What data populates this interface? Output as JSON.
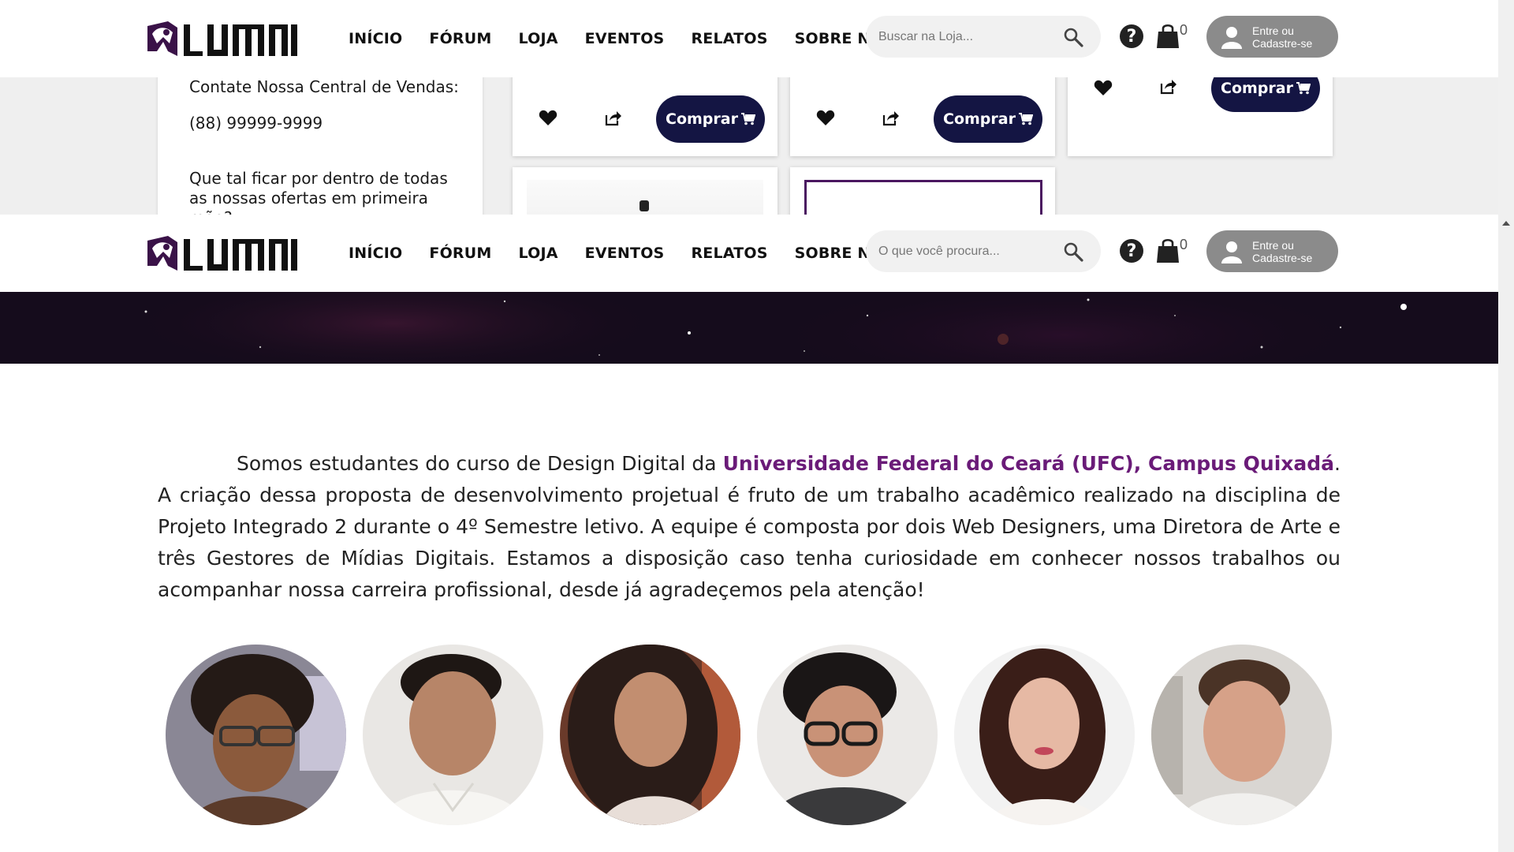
{
  "brand": {
    "name": "LUMNI",
    "accent": "#6a1b78",
    "dark_button": "#141543"
  },
  "nav": {
    "items": [
      "INÍCIO",
      "FÓRUM",
      "LOJA",
      "EVENTOS",
      "RELATOS",
      "SOBRE NÓS"
    ]
  },
  "top_header": {
    "search_placeholder": "Buscar na Loja...",
    "cart_count": "0",
    "login_line1": "Entre ou",
    "login_line2": "Cadastre-se"
  },
  "main_header": {
    "search_placeholder": "O que você procura...",
    "cart_count": "0",
    "login_line1": "Entre ou",
    "login_line2": "Cadastre-se"
  },
  "contact": {
    "title": "Contate Nossa Central de Vendas:",
    "phone": "(88) 99999-9999",
    "promo": "Que tal ficar por dentro de todas as nossas ofertas em primeira mão?"
  },
  "products": {
    "buy_label": "Comprar"
  },
  "about": {
    "intro": "Somos estudantes do curso de Design Digital da ",
    "university": "Universidade Federal do Ceará (UFC), Campus Quixadá",
    "rest": ". A criação dessa proposta de desenvolvimento projetual é fruto de um trabalho acadêmico realizado na disciplina de Projeto Integrado 2 durante o 4º Semestre letivo. A equipe é composta por dois Web Designers, uma Diretora de Arte e três Gestores de Mídias Digitais. Estamos a disposição caso tenha curiosidade em conhecer nossos trabalhos ou acompanhar nossa carreira profissional, desde já agradeçemos pela atenção!"
  },
  "icons": {
    "search": "search-icon",
    "help": "help-icon",
    "cart": "shopping-bag-icon",
    "user": "user-icon",
    "heart": "heart-icon",
    "share": "share-icon",
    "buy_cart": "cart-icon"
  },
  "team": {
    "count": 6
  }
}
